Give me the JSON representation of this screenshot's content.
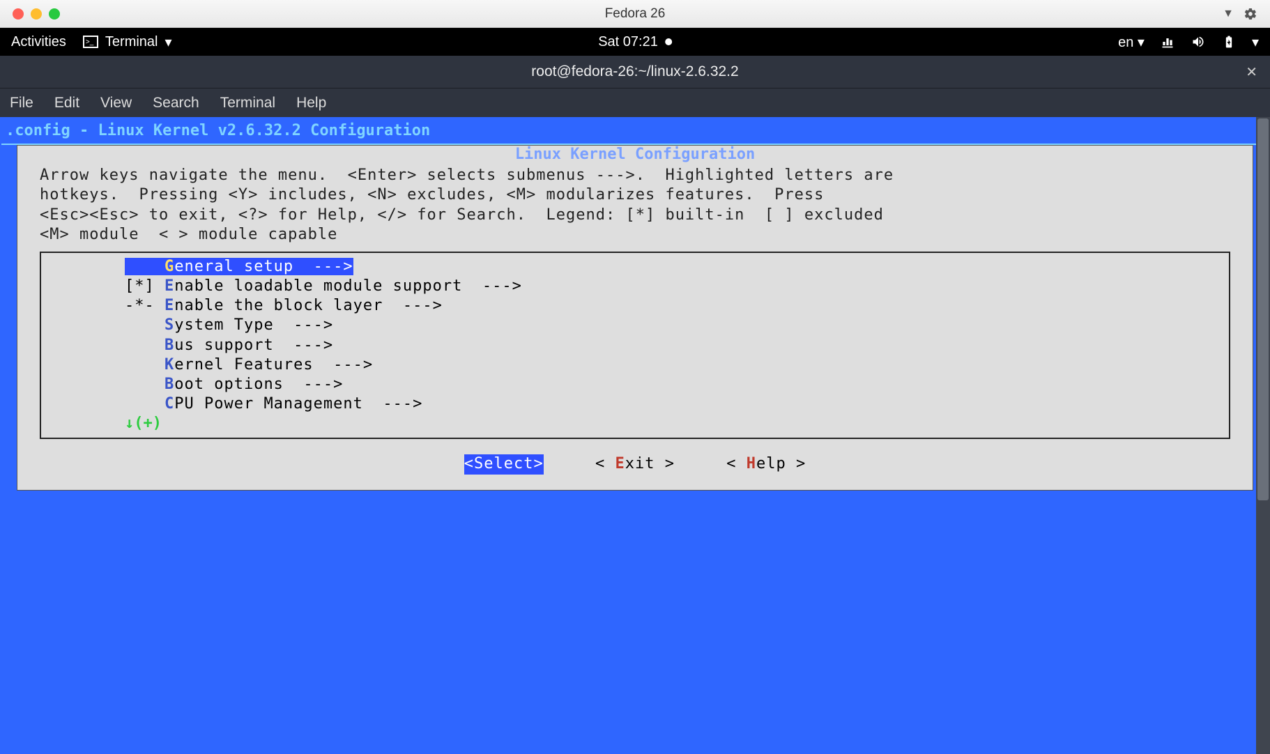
{
  "mac": {
    "title": "Fedora 26"
  },
  "gnome": {
    "activities": "Activities",
    "app": "Terminal",
    "clock": "Sat 07:21",
    "lang": "en"
  },
  "termwin": {
    "title": "root@fedora-26:~/linux-2.6.32.2",
    "menus": [
      "File",
      "Edit",
      "View",
      "Search",
      "Terminal",
      "Help"
    ]
  },
  "config": {
    "header": ".config - Linux Kernel v2.6.32.2 Configuration",
    "dialog_title": "Linux Kernel Configuration",
    "instructions": "Arrow keys navigate the menu.  <Enter> selects submenus --->.  Highlighted letters are\nhotkeys.  Pressing <Y> includes, <N> excludes, <M> modularizes features.  Press\n<Esc><Esc> to exit, <?> for Help, </> for Search.  Legend: [*] built-in  [ ] excluded\n<M> module  < > module capable",
    "items": [
      {
        "prefix": "    ",
        "hot": "G",
        "rest": "eneral setup  --->",
        "selected": true
      },
      {
        "prefix": "[*] ",
        "hot": "E",
        "rest": "nable loadable module support  --->",
        "selected": false
      },
      {
        "prefix": "-*- ",
        "hot": "E",
        "rest": "nable the block layer  --->",
        "selected": false
      },
      {
        "prefix": "    ",
        "hot": "S",
        "rest": "ystem Type  --->",
        "selected": false
      },
      {
        "prefix": "    ",
        "hot": "B",
        "rest": "us support  --->",
        "selected": false
      },
      {
        "prefix": "    ",
        "hot": "K",
        "rest": "ernel Features  --->",
        "selected": false
      },
      {
        "prefix": "    ",
        "hot": "B",
        "rest": "oot options  --->",
        "selected": false
      },
      {
        "prefix": "    ",
        "hot": "C",
        "rest": "PU Power Management  --->",
        "selected": false
      }
    ],
    "more": "↓(+)",
    "buttons": {
      "select": "<Select>",
      "exit_l": "< ",
      "exit_h": "E",
      "exit_r": "xit >",
      "help_l": "< ",
      "help_h": "H",
      "help_r": "elp >"
    }
  }
}
